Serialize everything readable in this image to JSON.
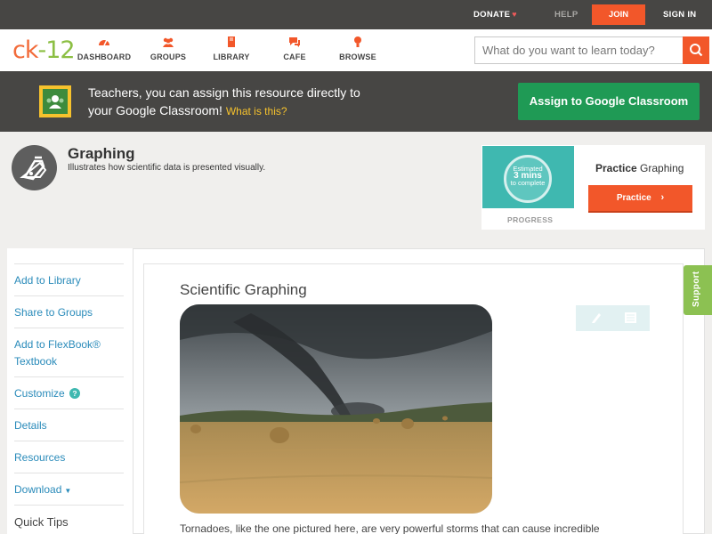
{
  "topbar": {
    "donate": "DONATE",
    "help": "HELP",
    "join": "JOIN",
    "signin": "SIGN IN"
  },
  "nav": {
    "logo": {
      "ck": "ck",
      "dash": "-",
      "num": "12"
    },
    "items": [
      {
        "label": "DASHBOARD",
        "icon": "dashboard-icon"
      },
      {
        "label": "GROUPS",
        "icon": "groups-icon"
      },
      {
        "label": "LIBRARY",
        "icon": "library-icon"
      },
      {
        "label": "CAFE",
        "icon": "cafe-icon"
      },
      {
        "label": "BROWSE",
        "icon": "browse-icon"
      }
    ],
    "search_placeholder": "What do you want to learn today?"
  },
  "classroom": {
    "line1": "Teachers, you can assign this resource directly to",
    "line2": "your Google Classroom!",
    "what": "What is this?",
    "button": "Assign to Google Classroom"
  },
  "concept": {
    "title": "Graphing",
    "description": "Illustrates how scientific data is presented visually."
  },
  "practice": {
    "estimated": "Estimated",
    "mins": "3 mins",
    "complete": "to complete",
    "progress_label": "PROGRESS",
    "title_bold": "Practice",
    "title_rest": "Graphing",
    "button": "Practice"
  },
  "sidebar": {
    "items": [
      "Add to Library",
      "Share to Groups",
      "Add to FlexBook®",
      "Textbook",
      "Customize",
      "Details",
      "Resources",
      "Download",
      "Quick Tips"
    ]
  },
  "article": {
    "title": "Scientific Graphing",
    "paragraph": "Tornadoes, like the one pictured here, are very powerful storms that can cause incredible"
  },
  "support": "Support",
  "colors": {
    "brand_orange": "#f2572a",
    "gc_green": "#1f9a55",
    "link_blue": "#2a8bba",
    "teal": "#3fb8b0",
    "support_green": "#8cc152"
  }
}
